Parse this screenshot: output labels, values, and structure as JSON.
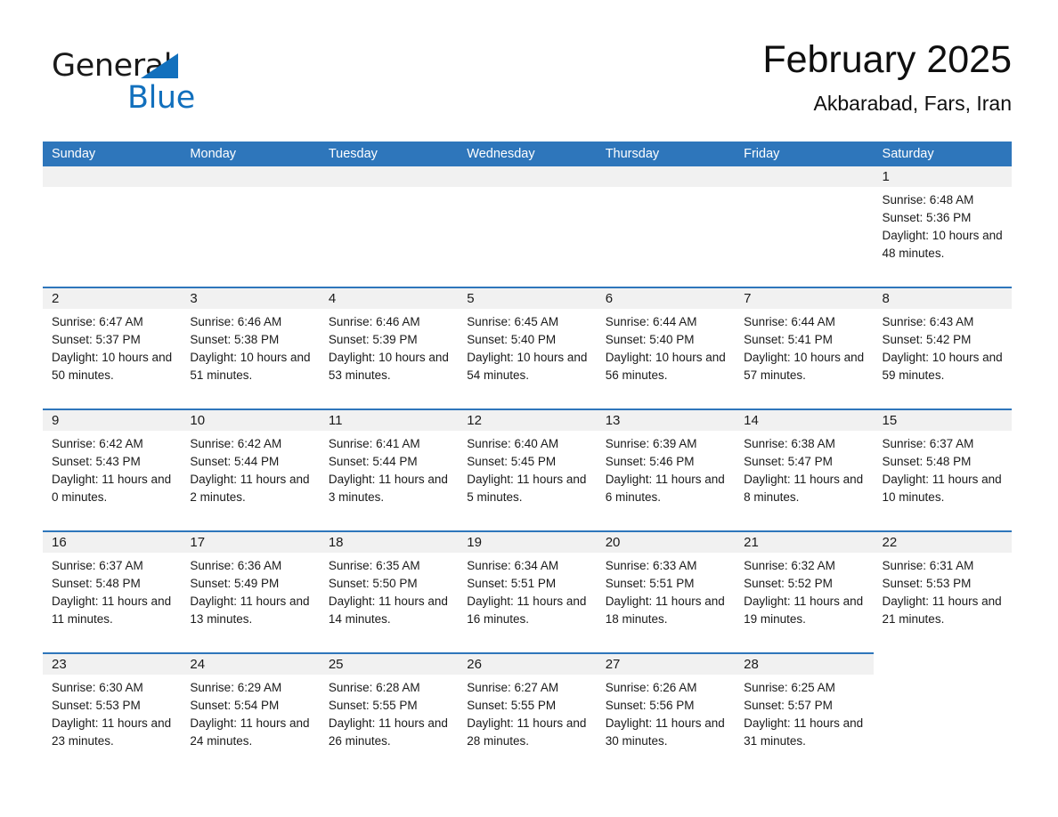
{
  "brand": {
    "name_part1": "General",
    "name_part2": "Blue",
    "triangle_color": "#1270bd"
  },
  "header": {
    "title": "February 2025",
    "subtitle": "Akbarabad, Fars, Iran"
  },
  "colors": {
    "header_blue": "#2e76bb",
    "day_bar_gray": "#f1f1f1",
    "text": "#1a1a1a"
  },
  "weekdays": [
    "Sunday",
    "Monday",
    "Tuesday",
    "Wednesday",
    "Thursday",
    "Friday",
    "Saturday"
  ],
  "weeks": [
    [
      {
        "day": "",
        "blank": true
      },
      {
        "day": "",
        "blank": true
      },
      {
        "day": "",
        "blank": true
      },
      {
        "day": "",
        "blank": true
      },
      {
        "day": "",
        "blank": true
      },
      {
        "day": "",
        "blank": true
      },
      {
        "day": "1",
        "sunrise": "Sunrise: 6:48 AM",
        "sunset": "Sunset: 5:36 PM",
        "daylight": "Daylight: 10 hours and 48 minutes."
      }
    ],
    [
      {
        "day": "2",
        "sunrise": "Sunrise: 6:47 AM",
        "sunset": "Sunset: 5:37 PM",
        "daylight": "Daylight: 10 hours and 50 minutes."
      },
      {
        "day": "3",
        "sunrise": "Sunrise: 6:46 AM",
        "sunset": "Sunset: 5:38 PM",
        "daylight": "Daylight: 10 hours and 51 minutes."
      },
      {
        "day": "4",
        "sunrise": "Sunrise: 6:46 AM",
        "sunset": "Sunset: 5:39 PM",
        "daylight": "Daylight: 10 hours and 53 minutes."
      },
      {
        "day": "5",
        "sunrise": "Sunrise: 6:45 AM",
        "sunset": "Sunset: 5:40 PM",
        "daylight": "Daylight: 10 hours and 54 minutes."
      },
      {
        "day": "6",
        "sunrise": "Sunrise: 6:44 AM",
        "sunset": "Sunset: 5:40 PM",
        "daylight": "Daylight: 10 hours and 56 minutes."
      },
      {
        "day": "7",
        "sunrise": "Sunrise: 6:44 AM",
        "sunset": "Sunset: 5:41 PM",
        "daylight": "Daylight: 10 hours and 57 minutes."
      },
      {
        "day": "8",
        "sunrise": "Sunrise: 6:43 AM",
        "sunset": "Sunset: 5:42 PM",
        "daylight": "Daylight: 10 hours and 59 minutes."
      }
    ],
    [
      {
        "day": "9",
        "sunrise": "Sunrise: 6:42 AM",
        "sunset": "Sunset: 5:43 PM",
        "daylight": "Daylight: 11 hours and 0 minutes."
      },
      {
        "day": "10",
        "sunrise": "Sunrise: 6:42 AM",
        "sunset": "Sunset: 5:44 PM",
        "daylight": "Daylight: 11 hours and 2 minutes."
      },
      {
        "day": "11",
        "sunrise": "Sunrise: 6:41 AM",
        "sunset": "Sunset: 5:44 PM",
        "daylight": "Daylight: 11 hours and 3 minutes."
      },
      {
        "day": "12",
        "sunrise": "Sunrise: 6:40 AM",
        "sunset": "Sunset: 5:45 PM",
        "daylight": "Daylight: 11 hours and 5 minutes."
      },
      {
        "day": "13",
        "sunrise": "Sunrise: 6:39 AM",
        "sunset": "Sunset: 5:46 PM",
        "daylight": "Daylight: 11 hours and 6 minutes."
      },
      {
        "day": "14",
        "sunrise": "Sunrise: 6:38 AM",
        "sunset": "Sunset: 5:47 PM",
        "daylight": "Daylight: 11 hours and 8 minutes."
      },
      {
        "day": "15",
        "sunrise": "Sunrise: 6:37 AM",
        "sunset": "Sunset: 5:48 PM",
        "daylight": "Daylight: 11 hours and 10 minutes."
      }
    ],
    [
      {
        "day": "16",
        "sunrise": "Sunrise: 6:37 AM",
        "sunset": "Sunset: 5:48 PM",
        "daylight": "Daylight: 11 hours and 11 minutes."
      },
      {
        "day": "17",
        "sunrise": "Sunrise: 6:36 AM",
        "sunset": "Sunset: 5:49 PM",
        "daylight": "Daylight: 11 hours and 13 minutes."
      },
      {
        "day": "18",
        "sunrise": "Sunrise: 6:35 AM",
        "sunset": "Sunset: 5:50 PM",
        "daylight": "Daylight: 11 hours and 14 minutes."
      },
      {
        "day": "19",
        "sunrise": "Sunrise: 6:34 AM",
        "sunset": "Sunset: 5:51 PM",
        "daylight": "Daylight: 11 hours and 16 minutes."
      },
      {
        "day": "20",
        "sunrise": "Sunrise: 6:33 AM",
        "sunset": "Sunset: 5:51 PM",
        "daylight": "Daylight: 11 hours and 18 minutes."
      },
      {
        "day": "21",
        "sunrise": "Sunrise: 6:32 AM",
        "sunset": "Sunset: 5:52 PM",
        "daylight": "Daylight: 11 hours and 19 minutes."
      },
      {
        "day": "22",
        "sunrise": "Sunrise: 6:31 AM",
        "sunset": "Sunset: 5:53 PM",
        "daylight": "Daylight: 11 hours and 21 minutes."
      }
    ],
    [
      {
        "day": "23",
        "sunrise": "Sunrise: 6:30 AM",
        "sunset": "Sunset: 5:53 PM",
        "daylight": "Daylight: 11 hours and 23 minutes."
      },
      {
        "day": "24",
        "sunrise": "Sunrise: 6:29 AM",
        "sunset": "Sunset: 5:54 PM",
        "daylight": "Daylight: 11 hours and 24 minutes."
      },
      {
        "day": "25",
        "sunrise": "Sunrise: 6:28 AM",
        "sunset": "Sunset: 5:55 PM",
        "daylight": "Daylight: 11 hours and 26 minutes."
      },
      {
        "day": "26",
        "sunrise": "Sunrise: 6:27 AM",
        "sunset": "Sunset: 5:55 PM",
        "daylight": "Daylight: 11 hours and 28 minutes."
      },
      {
        "day": "27",
        "sunrise": "Sunrise: 6:26 AM",
        "sunset": "Sunset: 5:56 PM",
        "daylight": "Daylight: 11 hours and 30 minutes."
      },
      {
        "day": "28",
        "sunrise": "Sunrise: 6:25 AM",
        "sunset": "Sunset: 5:57 PM",
        "daylight": "Daylight: 11 hours and 31 minutes."
      },
      {
        "day": "",
        "blank": true
      }
    ]
  ]
}
